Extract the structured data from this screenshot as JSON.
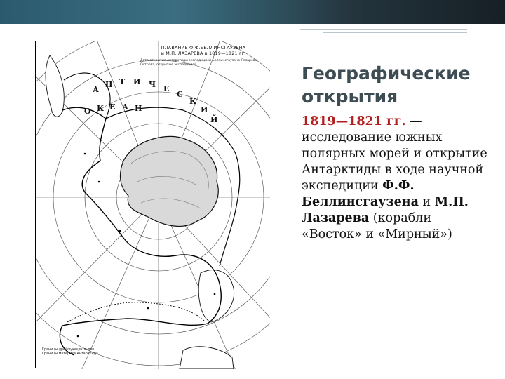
{
  "slide": {
    "title": "Географические открытия",
    "dates": "1819—1821 гг.",
    "text_part1": " — исследование южных полярных морей и открытие Антарктиды в ходе научной экспедиции ",
    "name1": "Ф.Ф. Беллинсгаузена",
    "text_and": " и ",
    "name2": "М.П. Лазарева",
    "text_part2": " (корабли «Восток» и «Мирный»)"
  },
  "map": {
    "legend_title_line1": "ПЛАВАНИЕ Ф.Ф.БЕЛЛИНСГАУЗЕНА",
    "legend_title_line2": "и М.П. ЛАЗАРЕВА в 1819—1821 гг.",
    "legend_item1": "Дата открытия Антарктиды экспедицией Беллинсгаузена-Лазарева",
    "legend_item2": "Острова, открытые экспедицией",
    "ocean_letters": [
      "А",
      "Н",
      "Т",
      "И",
      "Ч",
      "Е",
      "С",
      "К",
      "И",
      "Й"
    ],
    "ocean_word2": [
      "О",
      "К",
      "Е",
      "А",
      "Н"
    ],
    "note_line1": "Границы дрейфующих льдов",
    "note_line2": "Границы материка Антарктида"
  }
}
